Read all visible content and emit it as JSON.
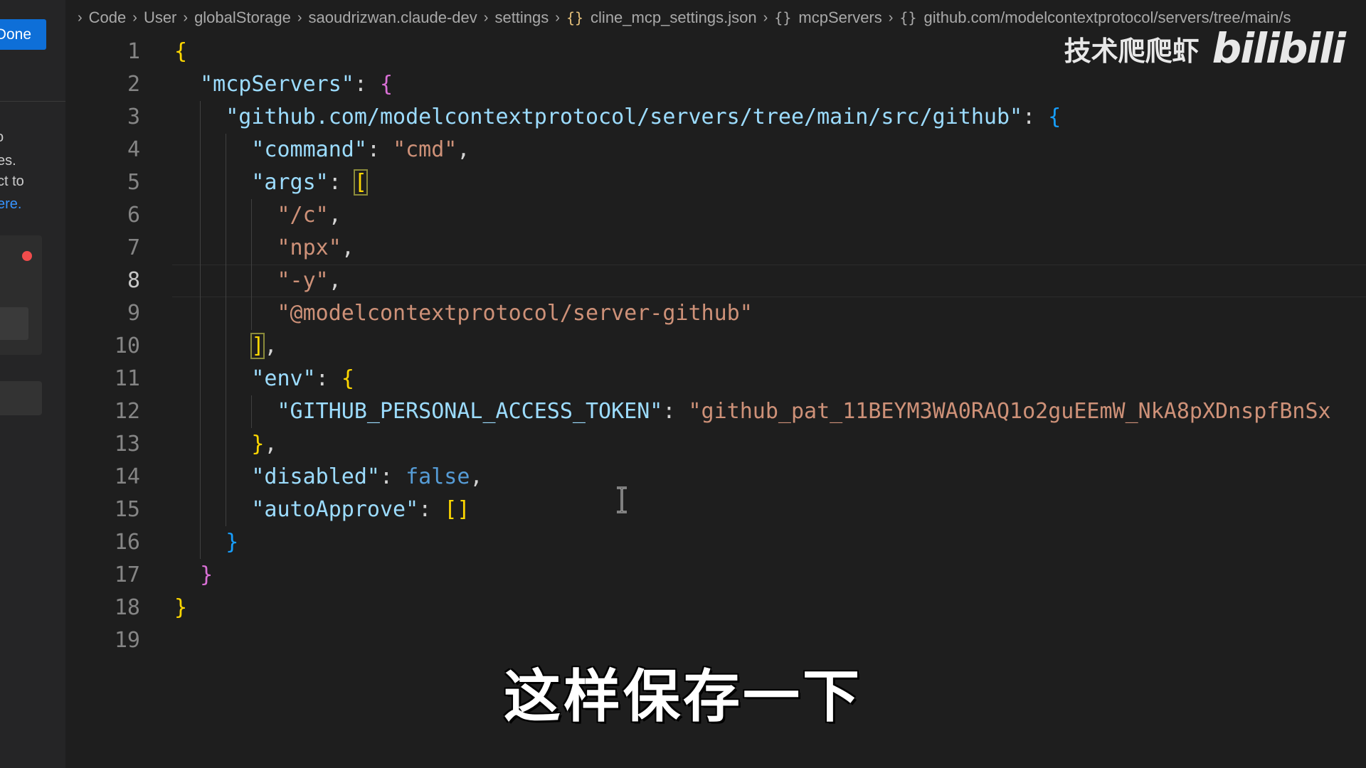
{
  "side_panel": {
    "done_label": "Done",
    "text_lines": [
      "o",
      "es.",
      "ct to",
      "ere."
    ]
  },
  "breadcrumb": {
    "items": [
      "Code",
      "User",
      "globalStorage",
      "saoudrizwan.claude-dev",
      "settings",
      "cline_mcp_settings.json",
      "mcpServers",
      "github.com/modelcontextprotocol/servers/tree/main/s"
    ]
  },
  "editor": {
    "current_line": 8,
    "lines": [
      "{",
      "  \"mcpServers\": {",
      "    \"github.com/modelcontextprotocol/servers/tree/main/src/github\": {",
      "      \"command\": \"cmd\",",
      "      \"args\": [",
      "        \"/c\",",
      "        \"npx\",",
      "        \"-y\",",
      "        \"@modelcontextprotocol/server-github\"",
      "      ],",
      "      \"env\": {",
      "        \"GITHUB_PERSONAL_ACCESS_TOKEN\": \"github_pat_11BEYM3WA0RAQ1o2guEEmW_NkA8pXDnspfBnSx",
      "      },",
      "      \"disabled\": false,",
      "      \"autoApprove\": []",
      "    }",
      "  }",
      "}",
      ""
    ]
  },
  "watermark": {
    "author": "技术爬爬虾",
    "logo": "bilibili"
  },
  "subtitle": "这样保存一下",
  "colors": {
    "key": "#9cdcfe",
    "string": "#ce9178",
    "keyword": "#569cd6",
    "bracket_level1": "#ffd700",
    "bracket_level2": "#da70d6",
    "bracket_level3": "#179fff",
    "done_button": "#0e6fd8"
  }
}
